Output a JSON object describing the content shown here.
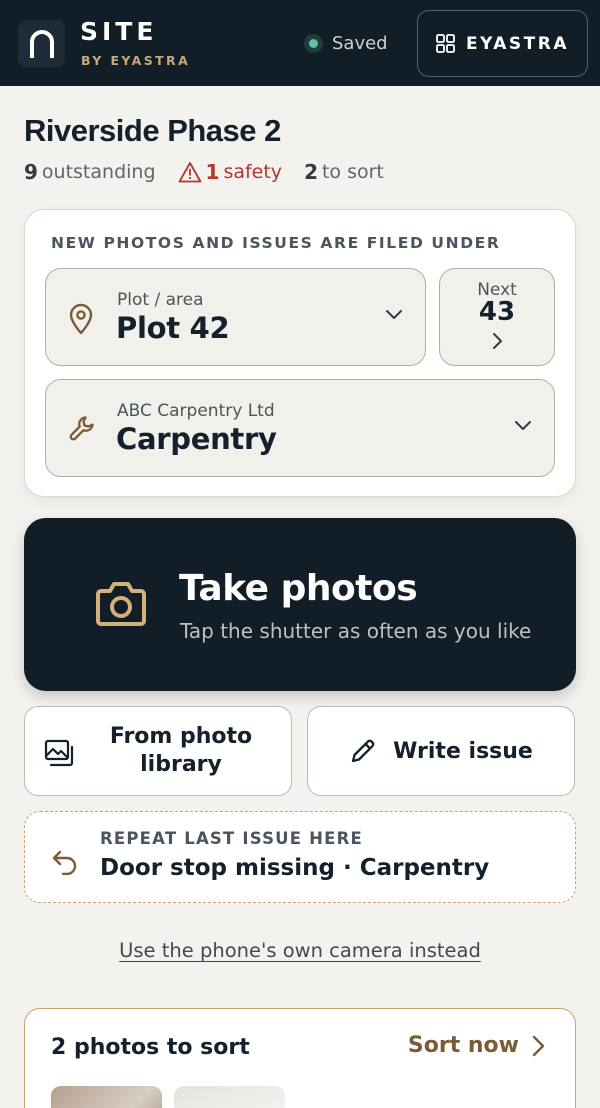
{
  "header": {
    "brand_title": "SITE",
    "brand_subtitle": "BY EYASTRA",
    "save_status": "Saved",
    "app_switch_label": "EYASTRA"
  },
  "project": {
    "title": "Riverside Phase 2",
    "stats": {
      "outstanding_count": "9",
      "outstanding_label": "outstanding",
      "safety_count": "1",
      "safety_label": "safety",
      "to_sort_count": "2",
      "to_sort_label": "to sort"
    }
  },
  "filing": {
    "heading": "NEW PHOTOS AND ISSUES ARE FILED UNDER",
    "plot": {
      "small_label": "Plot / area",
      "value": "Plot 42"
    },
    "next": {
      "label": "Next",
      "value": "43"
    },
    "trade": {
      "small_label": "ABC Carpentry Ltd",
      "value": "Carpentry"
    }
  },
  "take_photos": {
    "title": "Take photos",
    "subtitle": "Tap the shutter as often as you like"
  },
  "actions": {
    "library_label": "From photo library",
    "write_issue_label": "Write issue"
  },
  "repeat": {
    "label": "REPEAT LAST ISSUE HERE",
    "value": "Door stop missing · Carpentry"
  },
  "own_camera_link": "Use the phone's own camera instead",
  "sort_card": {
    "title": "2 photos to sort",
    "action_label": "Sort now"
  },
  "colors": {
    "header_bg": "#111d27",
    "accent_gold": "#c8a976",
    "safety_red": "#b5352d",
    "saved_green": "#5fc3a3"
  },
  "icons": {
    "logo": "arch-logo-icon",
    "app_grid": "grid-icon",
    "safety": "warning-triangle-icon",
    "plot": "map-pin-icon",
    "trade": "wrench-icon",
    "camera": "camera-icon",
    "library": "photo-library-icon",
    "write": "pencil-icon",
    "repeat": "undo-arrow-icon"
  }
}
